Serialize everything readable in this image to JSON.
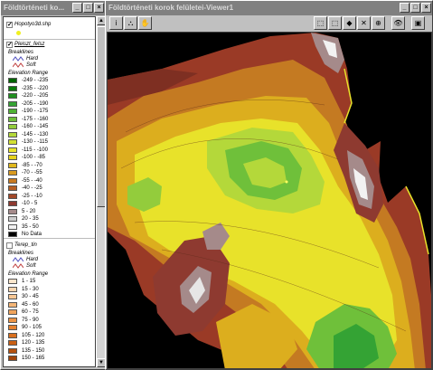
{
  "legend_window": {
    "title": "Földtörténeti ko...",
    "buttons": [
      "_",
      "□",
      "×"
    ]
  },
  "viewer_window": {
    "title": "Földtörténeti korok felületei-Viewer1",
    "buttons": [
      "_",
      "□",
      "×"
    ]
  },
  "toolbar": {
    "left_tools": [
      {
        "icon": "info-icon",
        "glyph": "i"
      },
      {
        "icon": "layers-icon",
        "glyph": "⛬"
      },
      {
        "icon": "hand-icon",
        "glyph": "✋"
      }
    ],
    "right_tools": [
      {
        "icon": "navigate-icon",
        "glyph": "⬚"
      },
      {
        "icon": "navigate-alt-icon",
        "glyph": "⬚"
      },
      {
        "icon": "perspective-icon",
        "glyph": "◆"
      },
      {
        "icon": "zoom-full-icon",
        "glyph": "✕"
      },
      {
        "icon": "zoom-in-icon",
        "glyph": "⊕"
      },
      {
        "icon": "eye-icon",
        "glyph": "👁"
      },
      {
        "icon": "save-icon",
        "glyph": "▣"
      }
    ]
  },
  "themes": [
    {
      "name": "Hopotyo3d.shp",
      "checked": true,
      "symbol_color": "#f0f020"
    },
    {
      "name": "Pleiszt_felsz",
      "checked": true,
      "breaklines_label": "Breaklines",
      "hard_label": "Hard",
      "soft_label": "Soft",
      "range_label": "Elevation Range",
      "classes": [
        {
          "label": "-249 - -235",
          "color": "#006400"
        },
        {
          "label": "-235 - -220",
          "color": "#0b7a0b"
        },
        {
          "label": "-220 - -205",
          "color": "#1f8f1f"
        },
        {
          "label": "-205 - -190",
          "color": "#34a334"
        },
        {
          "label": "-190 - -175",
          "color": "#4fb234"
        },
        {
          "label": "-175 - -160",
          "color": "#6fc03a"
        },
        {
          "label": "-160 - -145",
          "color": "#93cc3c"
        },
        {
          "label": "-145 - -130",
          "color": "#b4d83a"
        },
        {
          "label": "-130 - -115",
          "color": "#d2e034"
        },
        {
          "label": "-115 - -100",
          "color": "#e8e42a"
        },
        {
          "label": "-100 - -85",
          "color": "#e6d21c"
        },
        {
          "label": "-85 - -70",
          "color": "#e0b81e"
        },
        {
          "label": "-70 - -55",
          "color": "#d89a20"
        },
        {
          "label": "-55 - -40",
          "color": "#c97a20"
        },
        {
          "label": "-40 - -25",
          "color": "#b65e22"
        },
        {
          "label": "-25 - -10",
          "color": "#a24828"
        },
        {
          "label": "-10 - 5",
          "color": "#8e3a30"
        },
        {
          "label": "5 - 20",
          "color": "#a58a8a"
        },
        {
          "label": "20 - 35",
          "color": "#cccccc"
        },
        {
          "label": "35 - 50",
          "color": "#f2f2f2"
        },
        {
          "label": "No Data",
          "color": "#000000"
        }
      ]
    },
    {
      "name": "Terep_tin",
      "checked": false,
      "breaklines_label": "Breaklines",
      "hard_label": "Hard",
      "soft_label": "Soft",
      "range_label": "Elevation Range",
      "classes": [
        {
          "label": "1 - 15",
          "color": "#fde6cc"
        },
        {
          "label": "15 - 30",
          "color": "#fbd7b0"
        },
        {
          "label": "30 - 45",
          "color": "#f8c794"
        },
        {
          "label": "45 - 60",
          "color": "#f5b677"
        },
        {
          "label": "60 - 75",
          "color": "#f1a45c"
        },
        {
          "label": "75 - 90",
          "color": "#ec9344"
        },
        {
          "label": "90 - 105",
          "color": "#e5812f"
        },
        {
          "label": "105 - 120",
          "color": "#d9701f"
        },
        {
          "label": "120 - 135",
          "color": "#c95f14"
        },
        {
          "label": "135 - 150",
          "color": "#b5500d"
        },
        {
          "label": "150 - 165",
          "color": "#a04308"
        }
      ]
    }
  ]
}
